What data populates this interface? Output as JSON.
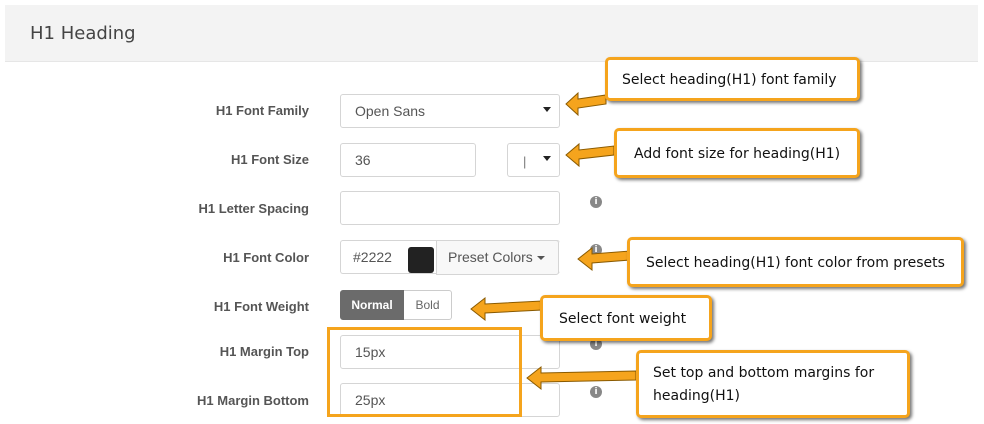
{
  "section": {
    "title": "H1 Heading"
  },
  "fields": {
    "font_family": {
      "label": "H1 Font Family",
      "value": "Open Sans"
    },
    "font_size": {
      "label": "H1 Font Size",
      "value": "36",
      "unit": "|"
    },
    "letter_spacing": {
      "label": "H1 Letter Spacing",
      "value": ""
    },
    "font_color": {
      "label": "H1 Font Color",
      "value": "#2222",
      "swatch": "#222222",
      "preset_label": "Preset Colors"
    },
    "font_weight": {
      "label": "H1 Font Weight",
      "options": [
        "Normal",
        "Bold"
      ],
      "selected": "Normal"
    },
    "margin_top": {
      "label": "H1 Margin Top",
      "value": "15px"
    },
    "margin_bottom": {
      "label": "H1 Margin Bottom",
      "value": "25px"
    }
  },
  "callouts": {
    "font_family": "Select heading(H1) font family",
    "font_size": "Add font size for heading(H1)",
    "font_color": "Select heading(H1) font color from presets",
    "font_weight": "Select font weight",
    "margins_line1": "Set top and bottom margins for",
    "margins_line2": "heading(H1)"
  },
  "icons": {
    "info": "info-icon",
    "dropdown": "chevron-down-icon",
    "callout_pointer": "arrow-left-icon"
  },
  "colors": {
    "accent": "#f5a41d",
    "swatch": "#222222"
  }
}
